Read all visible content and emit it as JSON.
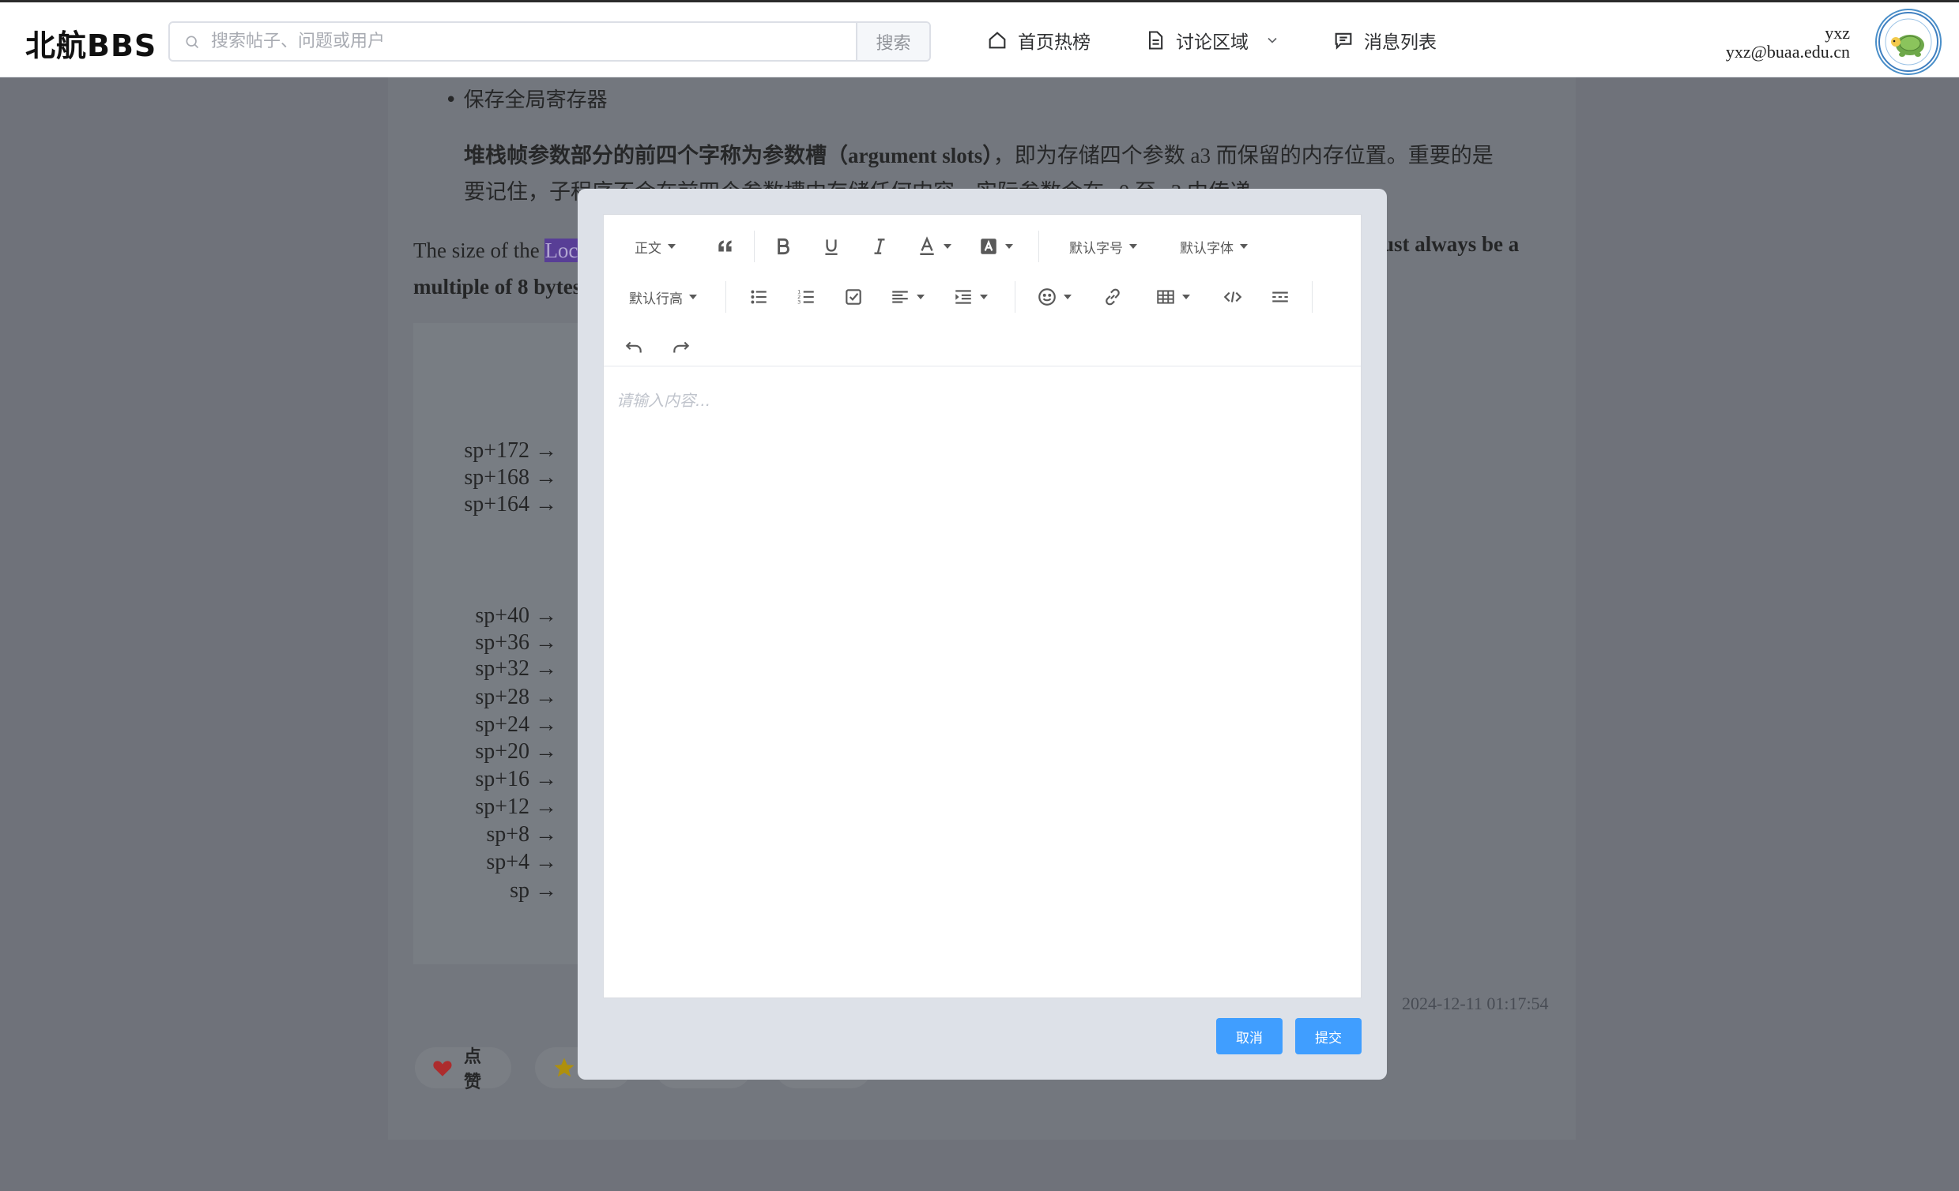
{
  "header": {
    "logo": "北航BBS",
    "search": {
      "placeholder": "搜索帖子、问题或用户",
      "value": "",
      "button_label": "搜索"
    },
    "nav": [
      {
        "label": "首页热榜",
        "icon": "home-icon"
      },
      {
        "label": "讨论区域",
        "icon": "document-icon",
        "has_dropdown": true
      },
      {
        "label": "消息列表",
        "icon": "message-icon"
      }
    ],
    "user": {
      "name": "yxz",
      "email": "yxz@buaa.edu.cn",
      "avatar_icon": "turtle-logo-avatar"
    }
  },
  "article": {
    "bullet_item": "保存全局寄存器",
    "slots_bold": "堆栈帧参数部分的前四个字称为参数槽（argument slots）",
    "slots_rest": "，即为存储四个参数 a3 而保留的内存位置。重要的是要记住，子程序不会在前四个参数槽中存储任何内容，实际参数会在 a0 至 a3 中传递。",
    "size_prefix": "The size of the ",
    "size_highlight": "Loca",
    "size_bold_right": "ust always be a",
    "size_bold_line2": "multiple of 8 bytes.",
    "stack_labels": [
      "sp+172 →",
      "sp+168 →",
      "sp+164 →",
      "sp+40 →",
      "sp+36 →",
      "sp+32 →",
      "sp+28 →",
      "sp+24 →",
      "sp+20 →",
      "sp+16 →",
      "sp+12 →",
      "sp+8 →",
      "sp+4 →",
      "sp →"
    ],
    "timestamp": "2024-12-11 01:17:54",
    "actions": [
      {
        "label": "点赞",
        "icon": "heart-icon"
      },
      {
        "label": "",
        "icon": "star-icon"
      },
      {
        "label": "",
        "icon": ""
      },
      {
        "label": "",
        "icon": ""
      }
    ]
  },
  "modal": {
    "toolbar": {
      "paragraph_label": "正文",
      "font_size_label": "默认字号",
      "font_family_label": "默认字体",
      "line_height_label": "默认行高"
    },
    "editor_placeholder": "请输入内容...",
    "cancel_label": "取消",
    "submit_label": "提交"
  },
  "colors": {
    "primary": "#409eff",
    "highlight": "#5f3ea8",
    "heart": "#e53935",
    "star": "#f5b800"
  }
}
